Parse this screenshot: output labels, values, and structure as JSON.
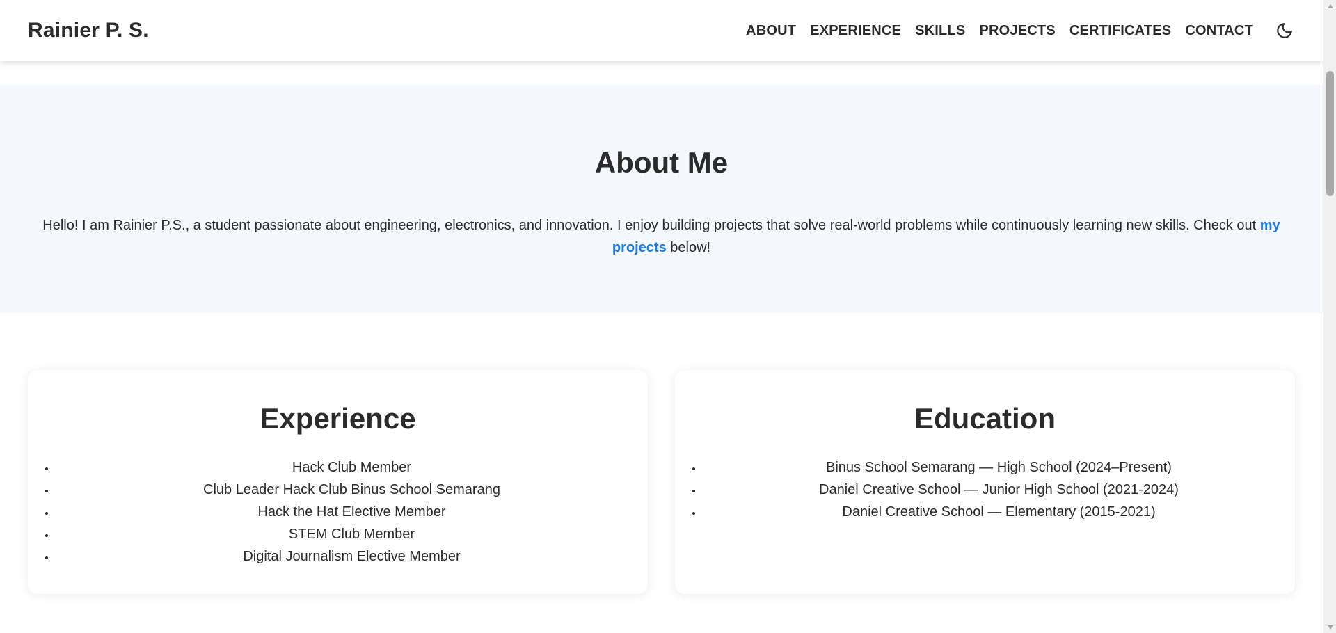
{
  "header": {
    "brand": "Rainier P. S.",
    "nav": [
      "ABOUT",
      "EXPERIENCE",
      "SKILLS",
      "PROJECTS",
      "CERTIFICATES",
      "CONTACT"
    ],
    "theme_icon": "moon-icon"
  },
  "about": {
    "title": "About Me",
    "text_before": "Hello! I am Rainier P.S., a student passionate about engineering, electronics, and innovation. I enjoy building projects that solve real-world problems while continuously learning new skills. Check out ",
    "link_text": "my projects",
    "text_after": " below!"
  },
  "experience": {
    "title": "Experience",
    "items": [
      "Hack Club Member",
      "Club Leader Hack Club Binus School Semarang",
      "Hack the Hat Elective Member",
      "STEM Club Member",
      "Digital Journalism Elective Member"
    ]
  },
  "education": {
    "title": "Education",
    "items": [
      "Binus School Semarang — High School (2024–Present)",
      "Daniel Creative School — Junior High School (2021-2024)",
      "Daniel Creative School — Elementary (2015-2021)"
    ]
  },
  "colors": {
    "text": "#2b2b2b",
    "link": "#1a7ae6",
    "about_bg": "#f4f8fd"
  }
}
